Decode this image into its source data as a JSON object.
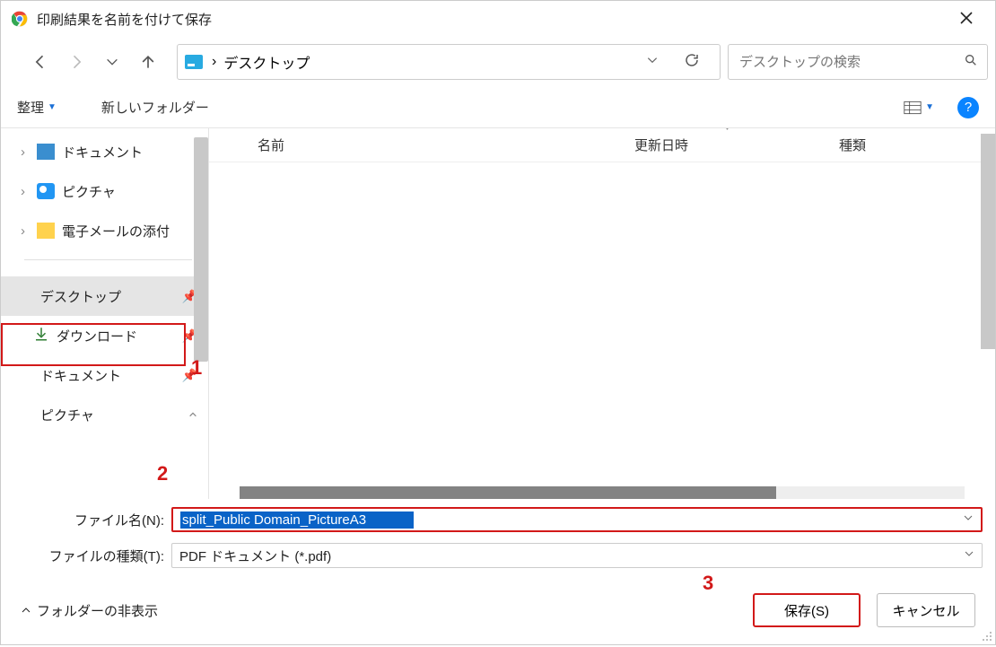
{
  "title": "印刷結果を名前を付けて保存",
  "path": {
    "crumb": "デスクトップ",
    "sep": "›"
  },
  "search": {
    "placeholder": "デスクトップの検索"
  },
  "cmd": {
    "organize": "整理",
    "new_folder": "新しいフォルダー"
  },
  "columns": {
    "name": "名前",
    "date": "更新日時",
    "type": "種類"
  },
  "tree": {
    "documents": "ドキュメント",
    "pictures": "ピクチャ",
    "email": "電子メールの添付",
    "desktop": "デスクトップ",
    "downloads": "ダウンロード",
    "documents2": "ドキュメント",
    "pictures2": "ピクチャ"
  },
  "filename": {
    "label": "ファイル名(N):",
    "value": "split_Public Domain_PictureA3"
  },
  "filetype": {
    "label": "ファイルの種類(T):",
    "value": "PDF ドキュメント (*.pdf)"
  },
  "footer": {
    "hide_folders": "フォルダーの非表示",
    "save": "保存(S)",
    "cancel": "キャンセル"
  },
  "annotations": {
    "n1": "1",
    "n2": "2",
    "n3": "3"
  }
}
